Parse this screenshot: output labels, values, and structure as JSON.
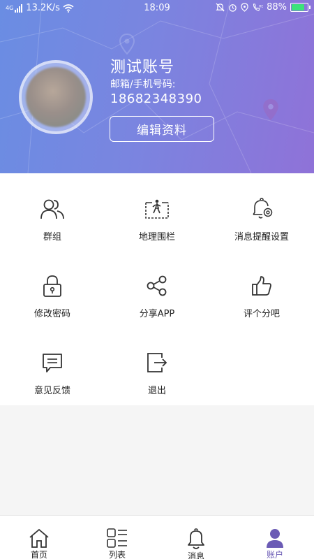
{
  "status_bar": {
    "network": "4G",
    "speed": "13.2K/s",
    "time": "18:09",
    "battery": "88%",
    "battery_level": 0.88
  },
  "profile": {
    "name": "测试账号",
    "contact_label": "邮箱/手机号码:",
    "phone": "18682348390",
    "edit_button": "编辑资料"
  },
  "menu": {
    "items": [
      {
        "label": "群组",
        "icon": "group-icon"
      },
      {
        "label": "地理围栏",
        "icon": "geofence-icon"
      },
      {
        "label": "消息提醒设置",
        "icon": "bell-settings-icon"
      },
      {
        "label": "修改密码",
        "icon": "lock-icon"
      },
      {
        "label": "分享APP",
        "icon": "share-icon"
      },
      {
        "label": "评个分吧",
        "icon": "thumbs-up-icon"
      },
      {
        "label": "意见反馈",
        "icon": "feedback-icon"
      },
      {
        "label": "退出",
        "icon": "logout-icon"
      }
    ]
  },
  "tabs": {
    "items": [
      {
        "label": "首页",
        "icon": "home-icon"
      },
      {
        "label": "列表",
        "icon": "list-icon"
      },
      {
        "label": "消息",
        "icon": "bell-icon"
      },
      {
        "label": "账户",
        "icon": "user-icon",
        "active": true
      }
    ]
  },
  "colors": {
    "header_start": "#6a8de3",
    "header_end": "#8f72d8",
    "active_tab": "#6b5bb5"
  }
}
